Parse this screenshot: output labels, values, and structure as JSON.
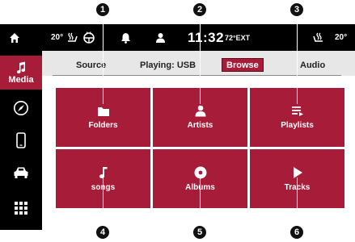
{
  "status_bar": {
    "temp_left": "20°",
    "clock": "11:32",
    "temp_ext": "72°EXT",
    "temp_right": "20°"
  },
  "sidebar": {
    "media_label": "Media"
  },
  "tabs": {
    "source": "Source",
    "playing": "Playing: USB",
    "browse": "Browse",
    "audio": "Audio"
  },
  "tiles": [
    {
      "label": "Folders",
      "icon": "folder-icon"
    },
    {
      "label": "Artists",
      "icon": "person-icon"
    },
    {
      "label": "Playlists",
      "icon": "playlist-icon"
    },
    {
      "label": "songs",
      "icon": "music-note-icon"
    },
    {
      "label": "Albums",
      "icon": "disc-icon"
    },
    {
      "label": "Tracks",
      "icon": "play-icon"
    }
  ],
  "callouts": [
    "1",
    "2",
    "3",
    "4",
    "5",
    "6"
  ],
  "colors": {
    "accent": "#a71c38",
    "bar": "#000000",
    "tabs_bg": "#e7e7e7"
  }
}
